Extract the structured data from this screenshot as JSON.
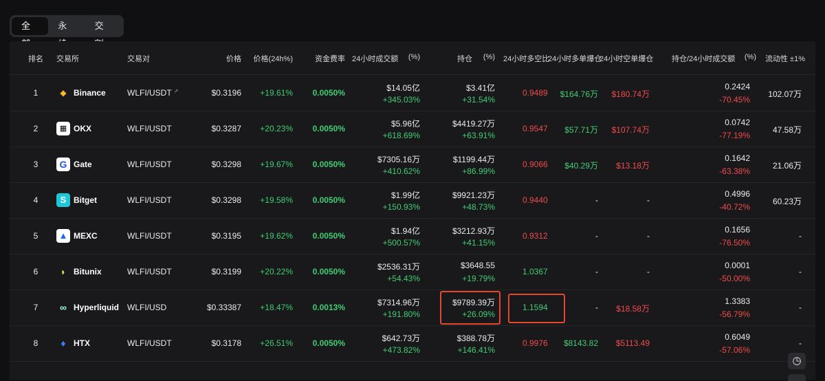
{
  "tabs": [
    "全部",
    "永续",
    "交割"
  ],
  "headers": {
    "rank": "排名",
    "exchange": "交易所",
    "pair": "交易对",
    "price": "价格",
    "change": "价格(24h%)",
    "funding": "资金费率",
    "volume": "24小时成交额",
    "volume_pct": "(%)",
    "oi": "持仓",
    "oi_pct": "(%)",
    "ls_ratio": "24小时多空比",
    "long_liq": "24小时多单爆仓",
    "short_liq": "24小时空单爆仓",
    "oi_vol": "持仓/24小时成交额",
    "oi_vol_pct": "(%)",
    "liquidity": "流动性 ±1%"
  },
  "rows": [
    {
      "rank": "1",
      "exchange": "Binance",
      "pair": "WLFI/USDT",
      "price": "$0.3196",
      "change": "+19.61%",
      "funding": "0.0050%",
      "volume": "$14.05亿",
      "volume_pct": "+345.03%",
      "oi": "$3.41亿",
      "oi_pct": "+31.54%",
      "ls_ratio": "0.9489",
      "long_liq": "$164.76万",
      "short_liq": "$180.74万",
      "oi_vol": "0.2424",
      "oi_vol_pct": "-70.45%",
      "liquidity": "102.07万"
    },
    {
      "rank": "2",
      "exchange": "OKX",
      "pair": "WLFI/USDT",
      "price": "$0.3287",
      "change": "+20.23%",
      "funding": "0.0050%",
      "volume": "$5.96亿",
      "volume_pct": "+618.69%",
      "oi": "$4419.27万",
      "oi_pct": "+63.91%",
      "ls_ratio": "0.9547",
      "long_liq": "$57.71万",
      "short_liq": "$107.74万",
      "oi_vol": "0.0742",
      "oi_vol_pct": "-77.19%",
      "liquidity": "47.58万"
    },
    {
      "rank": "3",
      "exchange": "Gate",
      "pair": "WLFI/USDT",
      "price": "$0.3298",
      "change": "+19.67%",
      "funding": "0.0050%",
      "volume": "$7305.16万",
      "volume_pct": "+410.62%",
      "oi": "$1199.44万",
      "oi_pct": "+86.99%",
      "ls_ratio": "0.9066",
      "long_liq": "$40.29万",
      "short_liq": "$13.18万",
      "oi_vol": "0.1642",
      "oi_vol_pct": "-63.38%",
      "liquidity": "21.06万"
    },
    {
      "rank": "4",
      "exchange": "Bitget",
      "pair": "WLFI/USDT",
      "price": "$0.3298",
      "change": "+19.58%",
      "funding": "0.0050%",
      "volume": "$1.99亿",
      "volume_pct": "+150.93%",
      "oi": "$9921.23万",
      "oi_pct": "+48.73%",
      "ls_ratio": "0.9440",
      "long_liq": "-",
      "short_liq": "-",
      "oi_vol": "0.4996",
      "oi_vol_pct": "-40.72%",
      "liquidity": "60.23万"
    },
    {
      "rank": "5",
      "exchange": "MEXC",
      "pair": "WLFI/USDT",
      "price": "$0.3195",
      "change": "+19.62%",
      "funding": "0.0050%",
      "volume": "$1.94亿",
      "volume_pct": "+500.57%",
      "oi": "$3212.93万",
      "oi_pct": "+41.15%",
      "ls_ratio": "0.9312",
      "long_liq": "-",
      "short_liq": "-",
      "oi_vol": "0.1656",
      "oi_vol_pct": "-76.50%",
      "liquidity": "-"
    },
    {
      "rank": "6",
      "exchange": "Bitunix",
      "pair": "WLFI/USDT",
      "price": "$0.3199",
      "change": "+20.22%",
      "funding": "0.0050%",
      "volume": "$2536.31万",
      "volume_pct": "+54.43%",
      "oi": "$3648.55",
      "oi_pct": "+19.79%",
      "ls_ratio": "1.0367",
      "long_liq": "-",
      "short_liq": "-",
      "oi_vol": "0.0001",
      "oi_vol_pct": "-50.00%",
      "liquidity": "-"
    },
    {
      "rank": "7",
      "exchange": "Hyperliquid",
      "pair": "WLFI/USD",
      "price": "$0.33387",
      "change": "+18.47%",
      "funding": "0.0013%",
      "volume": "$7314.96万",
      "volume_pct": "+191.80%",
      "oi": "$9789.39万",
      "oi_pct": "+26.09%",
      "ls_ratio": "1.1594",
      "long_liq": "-",
      "short_liq": "$18.58万",
      "oi_vol": "1.3383",
      "oi_vol_pct": "-56.79%",
      "liquidity": "-"
    },
    {
      "rank": "8",
      "exchange": "HTX",
      "pair": "WLFI/USDT",
      "price": "$0.3178",
      "change": "+26.51%",
      "funding": "0.0050%",
      "volume": "$642.73万",
      "volume_pct": "+473.82%",
      "oi": "$388.78万",
      "oi_pct": "+146.41%",
      "ls_ratio": "0.9976",
      "long_liq": "$8143.82",
      "short_liq": "$5113.49",
      "oi_vol": "0.6049",
      "oi_vol_pct": "-57.06%",
      "liquidity": "-"
    }
  ],
  "colors": {
    "up": "#3fce74",
    "down": "#f24b4b",
    "highlight": "#e5482e"
  }
}
